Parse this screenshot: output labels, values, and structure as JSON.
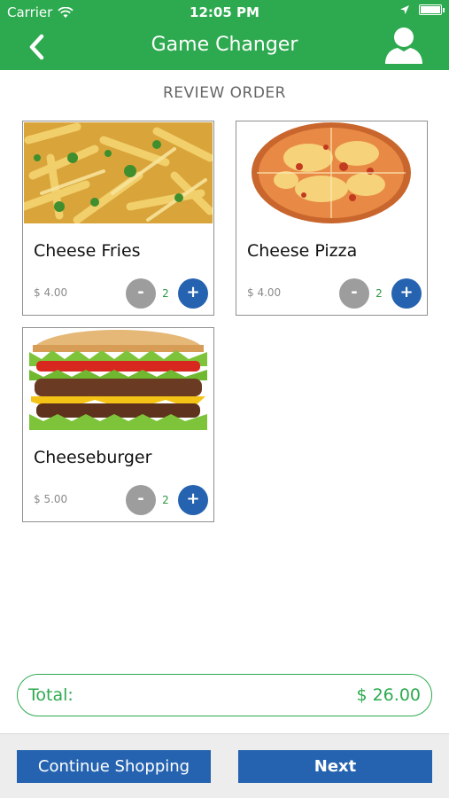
{
  "status_bar": {
    "carrier": "Carrier",
    "time": "12:05 PM"
  },
  "header": {
    "title": "Game Changer",
    "back_icon": "chevron-left-icon",
    "profile_icon": "user-icon"
  },
  "section_title": "REVIEW ORDER",
  "items": [
    {
      "name": "Cheese Fries",
      "price": "$ 4.00",
      "quantity": "2",
      "minus": "-",
      "plus": "+"
    },
    {
      "name": "Cheese Pizza",
      "price": "$ 4.00",
      "quantity": "2",
      "minus": "-",
      "plus": "+"
    },
    {
      "name": "Cheeseburger",
      "price": "$ 5.00",
      "quantity": "2",
      "minus": "-",
      "plus": "+"
    }
  ],
  "total": {
    "label": "Total:",
    "value": "$ 26.00"
  },
  "footer": {
    "continue_label": "Continue Shopping",
    "next_label": "Next"
  },
  "colors": {
    "primary_green": "#2daa4f",
    "button_blue": "#2563b0",
    "minus_gray": "#9d9d9d"
  }
}
